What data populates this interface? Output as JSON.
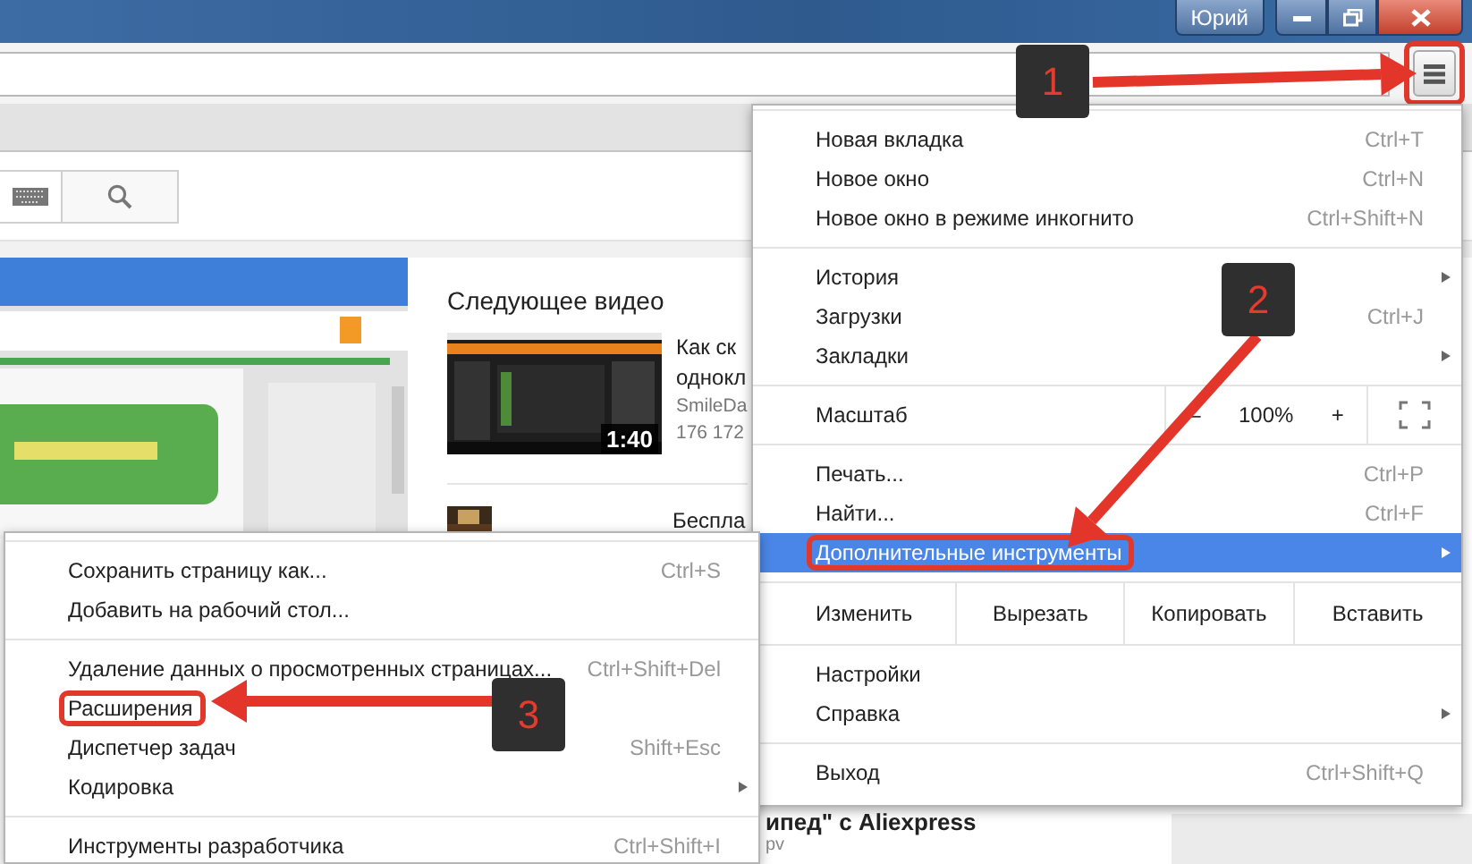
{
  "window": {
    "profile_name": "Юрий"
  },
  "toolbar": {
    "menu_button": {
      "outlined": true
    }
  },
  "page": {
    "next_heading": "Следующее видео",
    "videos": [
      {
        "title_lines": [
          "Как ск",
          "однокл"
        ],
        "channel": "SmileDa",
        "views": "176 172",
        "duration": "1:40"
      },
      {
        "title_lines": [
          "Беспла"
        ]
      }
    ],
    "lower_video": {
      "title": "ипед\" с Aliexpress",
      "meta": "pv"
    }
  },
  "main_menu": {
    "sections": [
      {
        "items": [
          {
            "kind": "item",
            "label": "Новая вкладка",
            "shortcut": "Ctrl+T",
            "submenu": false,
            "selected": false,
            "outlined": false
          },
          {
            "kind": "item",
            "label": "Новое окно",
            "shortcut": "Ctrl+N",
            "submenu": false,
            "selected": false,
            "outlined": false
          },
          {
            "kind": "item",
            "label": "Новое окно в режиме инкогнито",
            "shortcut": "Ctrl+Shift+N",
            "submenu": false,
            "selected": false,
            "outlined": false
          }
        ]
      },
      {
        "items": [
          {
            "kind": "item",
            "label": "История",
            "submenu": true,
            "selected": false,
            "outlined": false
          },
          {
            "kind": "item",
            "label": "Загрузки",
            "shortcut": "Ctrl+J",
            "submenu": false,
            "selected": false,
            "outlined": false
          },
          {
            "kind": "item",
            "label": "Закладки",
            "submenu": true,
            "selected": false,
            "outlined": false
          }
        ]
      },
      {
        "items": [
          {
            "kind": "zoom",
            "label": "Масштаб",
            "minus": "–",
            "value": "100%",
            "plus": "+"
          }
        ]
      },
      {
        "items": [
          {
            "kind": "item",
            "label": "Печать...",
            "shortcut": "Ctrl+P",
            "submenu": false,
            "selected": false,
            "outlined": false
          },
          {
            "kind": "item",
            "label": "Найти...",
            "shortcut": "Ctrl+F",
            "submenu": false,
            "selected": false,
            "outlined": false
          },
          {
            "kind": "item",
            "label": "Дополнительные инструменты",
            "submenu": true,
            "selected": true,
            "outlined": true
          }
        ]
      },
      {
        "items": [
          {
            "kind": "edit",
            "label": "Изменить",
            "actions": [
              "Вырезать",
              "Копировать",
              "Вставить"
            ]
          }
        ]
      },
      {
        "items": [
          {
            "kind": "item",
            "label": "Настройки",
            "submenu": false,
            "selected": false,
            "outlined": false
          },
          {
            "kind": "item",
            "label": "Справка",
            "submenu": true,
            "selected": false,
            "outlined": false
          }
        ]
      },
      {
        "items": [
          {
            "kind": "item",
            "label": "Выход",
            "shortcut": "Ctrl+Shift+Q",
            "submenu": false,
            "selected": false,
            "outlined": false
          }
        ]
      }
    ]
  },
  "submenu": {
    "sections": [
      {
        "items": [
          {
            "kind": "item",
            "label": "Сохранить страницу как...",
            "shortcut": "Ctrl+S",
            "submenu": false,
            "selected": false,
            "outlined": false
          },
          {
            "kind": "item",
            "label": "Добавить на рабочий стол...",
            "submenu": false,
            "selected": false,
            "outlined": false
          }
        ]
      },
      {
        "items": [
          {
            "kind": "item",
            "label": "Удаление данных о просмотренных страницах...",
            "shortcut": "Ctrl+Shift+Del",
            "submenu": false,
            "selected": false,
            "outlined": false
          },
          {
            "kind": "item",
            "label": "Расширения",
            "submenu": false,
            "selected": false,
            "outlined": true
          },
          {
            "kind": "item",
            "label": "Диспетчер задач",
            "shortcut": "Shift+Esc",
            "submenu": false,
            "selected": false,
            "outlined": false
          },
          {
            "kind": "item",
            "label": "Кодировка",
            "submenu": true,
            "selected": false,
            "outlined": false
          }
        ]
      },
      {
        "items": [
          {
            "kind": "item",
            "label": "Инструменты разработчика",
            "shortcut": "Ctrl+Shift+I",
            "submenu": false,
            "selected": false,
            "outlined": false
          }
        ]
      }
    ]
  },
  "annotations": [
    {
      "number": "1"
    },
    {
      "number": "2"
    },
    {
      "number": "3"
    }
  ]
}
